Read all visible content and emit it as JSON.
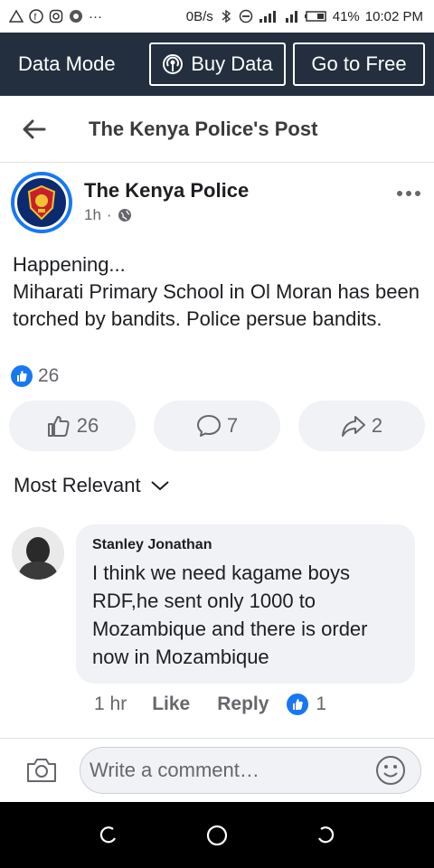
{
  "status_bar": {
    "speed": "0B/s",
    "battery": "41%",
    "time": "10:02 PM"
  },
  "data_bar": {
    "mode_label": "Data Mode",
    "buy_label": "Buy Data",
    "free_label": "Go to Free"
  },
  "header": {
    "title": "The Kenya Police's Post"
  },
  "post": {
    "author": "The Kenya Police",
    "time": "1h",
    "separator": "·",
    "lines": [
      "Happening...",
      "Miharati Primary School in Ol Moran has been torched by bandits. Police persue bandits."
    ],
    "reaction_count": "26",
    "actions": {
      "like_count": "26",
      "comment_count": "7",
      "share_count": "2"
    }
  },
  "comments": {
    "sort_label": "Most Relevant",
    "items": [
      {
        "name": "Stanley Jonathan",
        "text": "I think we need kagame boys RDF,he sent only 1000 to Mozambique and there is order now in Mozambique",
        "time": "1 hr",
        "like_label": "Like",
        "reply_label": "Reply",
        "reaction_count": "1"
      }
    ]
  },
  "composer": {
    "placeholder": "Write a comment…"
  },
  "colors": {
    "accent": "#1877f2",
    "data_bar_bg": "#232f3e",
    "bubble_bg": "#f0f2f5"
  }
}
